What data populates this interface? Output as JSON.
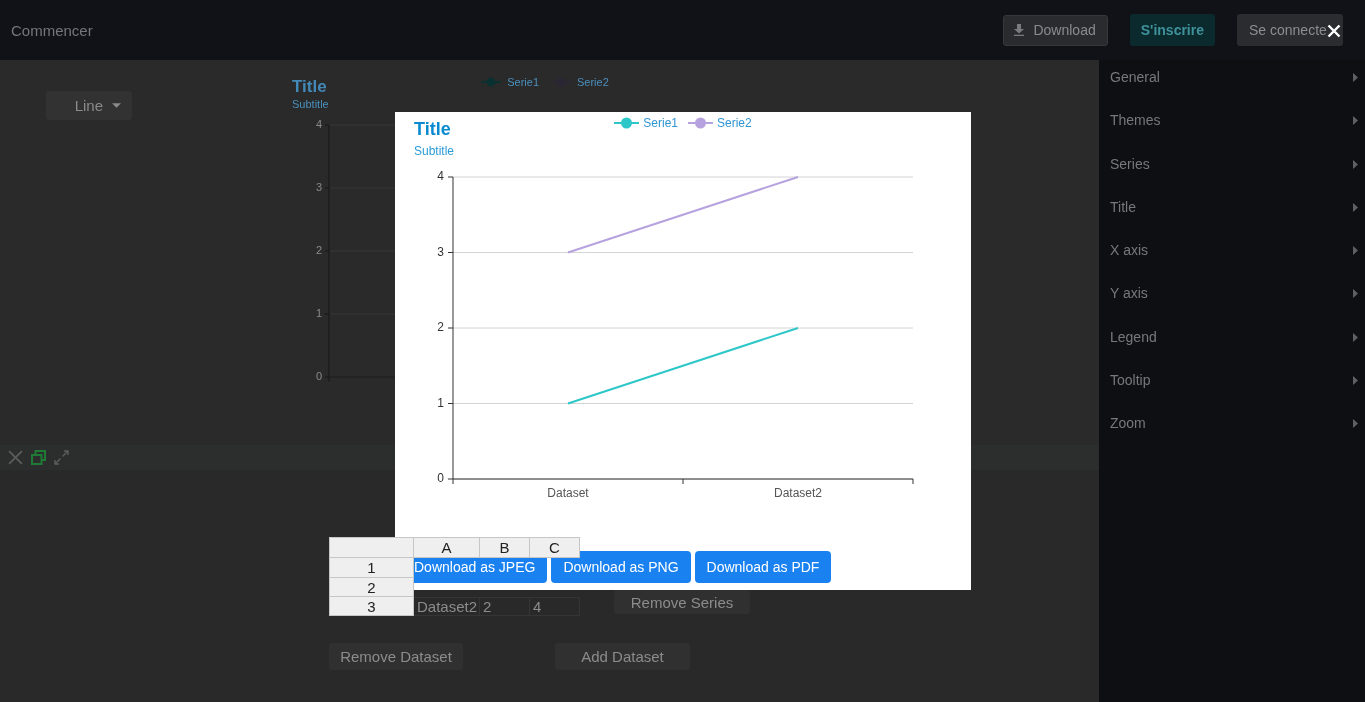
{
  "top_bar": {
    "title": "Commencer",
    "buttons": [
      {
        "kind": "download",
        "label": "Download"
      },
      {
        "kind": "signup",
        "label": "S'inscrire"
      },
      {
        "kind": "login",
        "label": "Se connecte"
      }
    ]
  },
  "editor": {
    "chart_type": "Line",
    "preview_chart": {
      "title": "Title",
      "subtitle": "Subtitle",
      "legend": [
        {
          "name": "Serie1",
          "color": "#0b3031"
        },
        {
          "name": "Serie2",
          "color": "#2a2633"
        }
      ],
      "y_axis_labels": [
        "4",
        "3",
        "2",
        "1",
        "0"
      ]
    },
    "spreadsheet": {
      "columns": [
        "A",
        "B",
        "C"
      ],
      "rows": [
        {
          "label": "1"
        },
        {
          "label": "2"
        },
        {
          "label": "3",
          "cells": [
            "Dataset2",
            "2",
            "4"
          ]
        }
      ]
    },
    "remove_series": "Remove Series",
    "remove_dataset": "Remove Dataset",
    "add_dataset": "Add Dataset"
  },
  "settings_menu": [
    {
      "label": "General",
      "expanded": false
    },
    {
      "label": "Themes",
      "expanded": false
    },
    {
      "label": "Series",
      "expanded": false
    },
    {
      "label": "Title",
      "expanded": false
    },
    {
      "label": "X axis",
      "expanded": false
    },
    {
      "label": "Y axis",
      "expanded": false
    },
    {
      "label": "Legend",
      "expanded": false
    },
    {
      "label": "Tooltip",
      "expanded": false
    },
    {
      "label": "Zoom",
      "expanded": false
    }
  ],
  "export_dialog": {
    "chart_data": {
      "type": "line",
      "title": "Title",
      "categories": [
        "Dataset",
        "Dataset2"
      ],
      "series": [
        {
          "name": "Serie1",
          "color": "#2ec7c9",
          "values": [
            1,
            2
          ]
        },
        {
          "name": "Serie2",
          "color": "#b6a2de",
          "values": [
            3,
            4
          ]
        }
      ],
      "ylim": [
        0,
        4
      ],
      "yticks": [
        0,
        1,
        2,
        3,
        4
      ],
      "grid": true,
      "legend": "top"
    },
    "subtitle": "Subtitle",
    "buttons": [
      "Download as JPEG",
      "Download as PNG",
      "Download as PDF"
    ]
  }
}
